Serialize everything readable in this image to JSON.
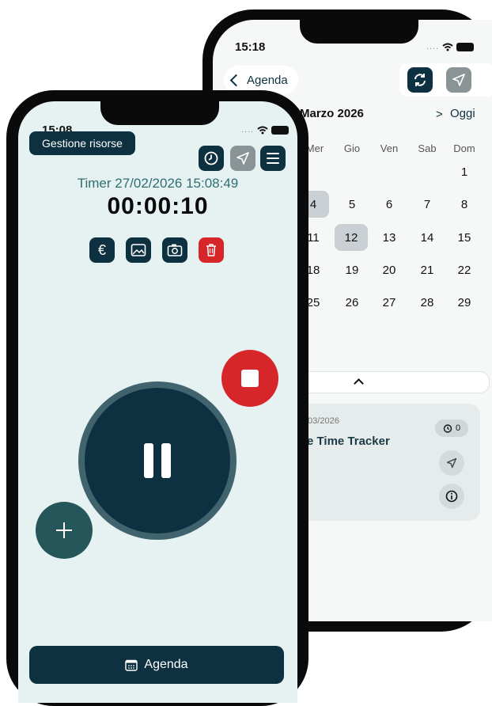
{
  "back_screen": {
    "status_time": "15:18",
    "back_label": "Agenda",
    "month_title": "Marzo 2026",
    "next_glyph": ">",
    "today_label": "Oggi",
    "weekdays": [
      "Mer",
      "Gio",
      "Ven",
      "Sab",
      "Dom"
    ],
    "weeks": [
      [
        "",
        "",
        "",
        "",
        "1"
      ],
      [
        "4",
        "5",
        "6",
        "7",
        "8"
      ],
      [
        "11",
        "12",
        "13",
        "14",
        "15"
      ],
      [
        "18",
        "19",
        "20",
        "21",
        "22"
      ],
      [
        "25",
        "26",
        "27",
        "28",
        "29"
      ]
    ],
    "event": {
      "date": "/03/2026",
      "title": "e Time Tracker",
      "badge_count": "0"
    }
  },
  "front_screen": {
    "status_time": "15:08",
    "resource_button": "Gestione risorse",
    "timer_label": "Timer 27/02/2026 15:08:49",
    "timer_value": "00:00:10",
    "bottom_button": "Agenda"
  },
  "colors": {
    "primary": "#0d3140",
    "accent_teal": "#2f6e73",
    "danger": "#d7262a",
    "background": "#e6f1f1"
  }
}
